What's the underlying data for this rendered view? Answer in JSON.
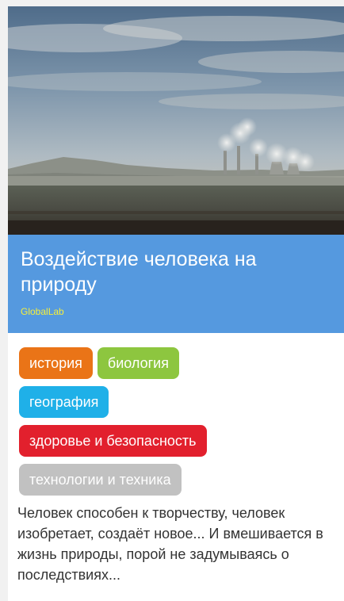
{
  "card": {
    "title": "Воздействие человека на природу",
    "author": "GlobalLab",
    "description": "Человек способен к творчеству, человек изобретает, создаёт новое... И вмешивается в жизнь природы, порой не задумываясь о последствиях...",
    "image_alt": "Дымящие трубы электростанции на фоне пасмурного неба и поля"
  },
  "tags": [
    {
      "label": "история",
      "color": "#ea7417"
    },
    {
      "label": "биология",
      "color": "#8dc63f"
    },
    {
      "label": "география",
      "color": "#1fb0e8"
    },
    {
      "label": "здоровье и безопасность",
      "color": "#e2202d"
    },
    {
      "label": "технологии и техника",
      "color": "#c1c1c1"
    }
  ],
  "colors": {
    "title_bar": "#5599df",
    "author": "#f5ee3b"
  }
}
